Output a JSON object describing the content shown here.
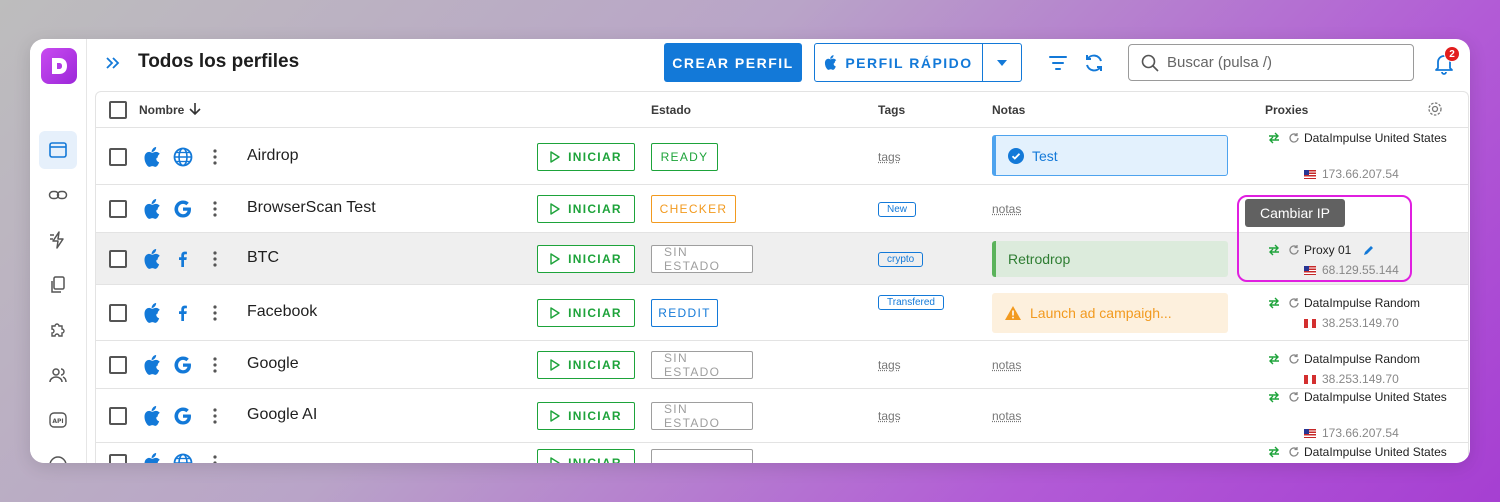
{
  "header": {
    "title": "Todos los perfiles",
    "crear_label": "CREAR PERFIL",
    "rapido_label": "PERFIL RÁPIDO",
    "search_placeholder": "Buscar (pulsa /)",
    "notification_count": "2"
  },
  "columns": {
    "nombre": "Nombre",
    "estado": "Estado",
    "tags": "Tags",
    "notas": "Notas",
    "proxies": "Proxies"
  },
  "iniciar_label": "INICIAR",
  "tooltip": "Cambiar IP",
  "colors": {
    "primary": "#1379d8",
    "green": "#1da33a",
    "orange": "#f29a1f",
    "grey": "#9e9e9e",
    "brand_purple": "#b23be6"
  },
  "rows": [
    {
      "name": "Airdrop",
      "os": "apple-icon",
      "browser": "globe-icon",
      "status": "READY",
      "status_color": "#1da33a",
      "tag": "tags",
      "tag_chip": false,
      "note": "Test",
      "note_kind": "blue",
      "proxy_name": "DataImpulse United States",
      "proxy_ip": "173.66.207.54",
      "flag": "us"
    },
    {
      "name": "BrowserScan Test",
      "os": "apple-icon",
      "browser": "google-icon",
      "status": "CHECKER",
      "status_color": "#f29a1f",
      "tag": "New",
      "tag_chip": true,
      "note": "notas",
      "note_kind": "plain",
      "proxy_name": "",
      "proxy_ip": "",
      "flag": ""
    },
    {
      "name": "BTC",
      "os": "apple-icon",
      "browser": "facebook-icon",
      "status": "SIN ESTADO",
      "status_color": "#9e9e9e",
      "tag": "crypto",
      "tag_chip": true,
      "note": "Retrodrop",
      "note_kind": "green",
      "proxy_name": "Proxy 01",
      "proxy_ip": "68.129.55.144",
      "flag": "us"
    },
    {
      "name": "Facebook",
      "os": "apple-icon",
      "browser": "facebook-icon",
      "status": "REDDIT",
      "status_color": "#1379d8",
      "tag": "Transfered",
      "tag_chip": true,
      "note": "Launch ad campaigh...",
      "note_kind": "orange",
      "proxy_name": "DataImpulse Random",
      "proxy_ip": "38.253.149.70",
      "flag": "pe"
    },
    {
      "name": "Google",
      "os": "apple-icon",
      "browser": "google-icon",
      "status": "SIN ESTADO",
      "status_color": "#9e9e9e",
      "tag": "tags",
      "tag_chip": false,
      "note": "notas",
      "note_kind": "plain",
      "proxy_name": "DataImpulse Random",
      "proxy_ip": "38.253.149.70",
      "flag": "pe"
    },
    {
      "name": "Google AI",
      "os": "apple-icon",
      "browser": "google-icon",
      "status": "SIN ESTADO",
      "status_color": "#9e9e9e",
      "tag": "tags",
      "tag_chip": false,
      "note": "notas",
      "note_kind": "plain",
      "proxy_name": "DataImpulse United States",
      "proxy_ip": "173.66.207.54",
      "flag": "us"
    },
    {
      "name": "",
      "os": "apple-icon",
      "browser": "globe-icon",
      "status": "",
      "status_color": "#9e9e9e",
      "tag": "",
      "tag_chip": false,
      "note": "",
      "note_kind": "plain",
      "proxy_name": "DataImpulse United States",
      "proxy_ip": "",
      "flag": ""
    }
  ]
}
